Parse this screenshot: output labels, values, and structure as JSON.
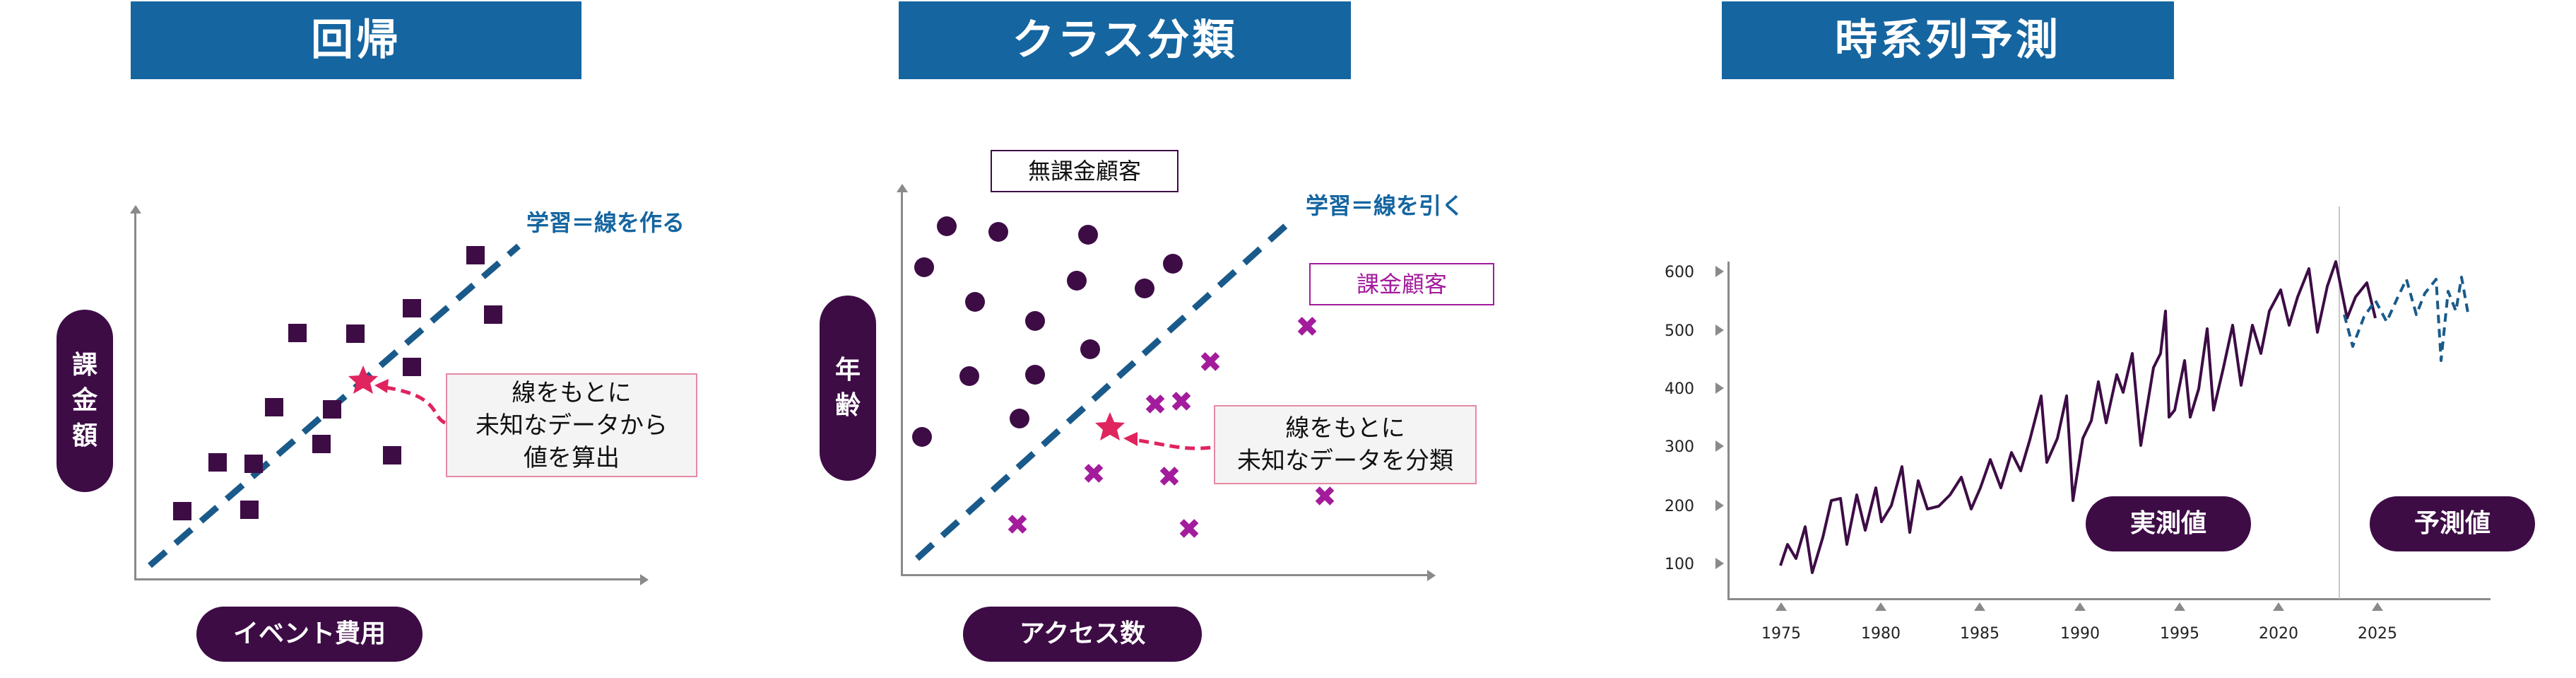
{
  "regression": {
    "title": "回帰",
    "line_label": "学習＝線を作る",
    "x_axis_label": "イベント費用",
    "y_axis_label": [
      "課",
      "金",
      "額"
    ],
    "callout": [
      "線をもとに",
      "未知なデータから",
      "値を算出"
    ]
  },
  "classification": {
    "title": "クラス分類",
    "line_label": "学習＝線を引く",
    "x_axis_label": "アクセス数",
    "y_axis_label": [
      "年",
      "齢"
    ],
    "class_a": "無課金顧客",
    "class_b": "課金顧客",
    "callout": [
      "線をもとに",
      "未知なデータを分類"
    ]
  },
  "timeseries": {
    "title": "時系列予測",
    "actual_label": "実測値",
    "forecast_label": "予測値",
    "y_ticks": [
      "600",
      "500",
      "400",
      "300",
      "200",
      "100"
    ],
    "x_ticks": [
      "1975",
      "1980",
      "1985",
      "1990",
      "1995",
      "2020",
      "2025"
    ]
  },
  "colors": {
    "title_bg": "#1565a0",
    "pill_bg": "#3d0c45",
    "point_dark": "#3d0c45",
    "point_magenta": "#a31c9c",
    "regression_line": "#1a5a8a",
    "star": "#e0245e"
  }
}
